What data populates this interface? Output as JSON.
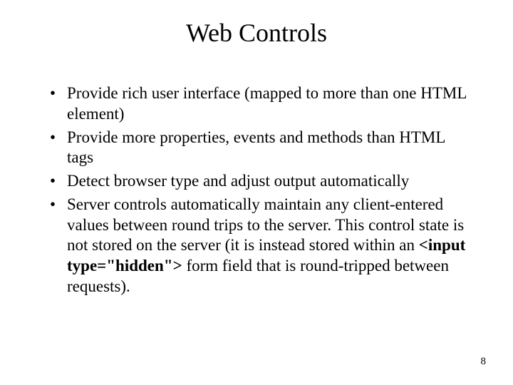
{
  "title": "Web Controls",
  "bullets": [
    {
      "text": "Provide rich user interface (mapped to more than one HTML element)"
    },
    {
      "text": "Provide more properties, events and methods than HTML tags"
    },
    {
      "text": "Detect browser type and adjust output automatically"
    },
    {
      "pre": "Server controls automatically maintain any client-entered values between round trips to the server. This control state is not stored on the server (it is instead stored within an ",
      "bold": "<input type=\"hidden\">",
      "post": " form field that is round-tripped between requests)."
    }
  ],
  "page_number": "8"
}
